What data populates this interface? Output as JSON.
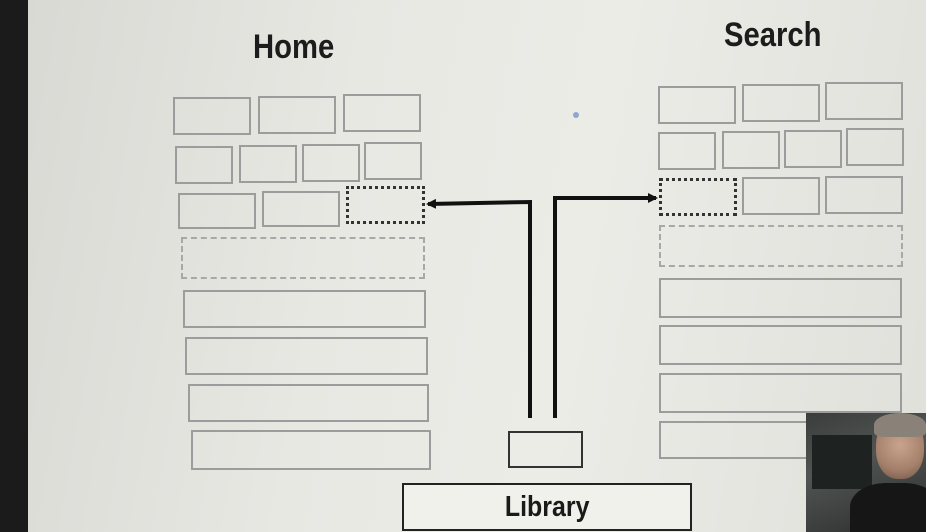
{
  "diagram": {
    "left_title": "Home",
    "right_title": "Search",
    "bottom_label": "Library"
  },
  "colors": {
    "tile_border": "#9c9c9c",
    "highlight_border": "#333333",
    "arrow": "#111111"
  },
  "icons": {
    "webcam": "webcam-thumbnail",
    "pointer": "laser-pointer-dot"
  }
}
